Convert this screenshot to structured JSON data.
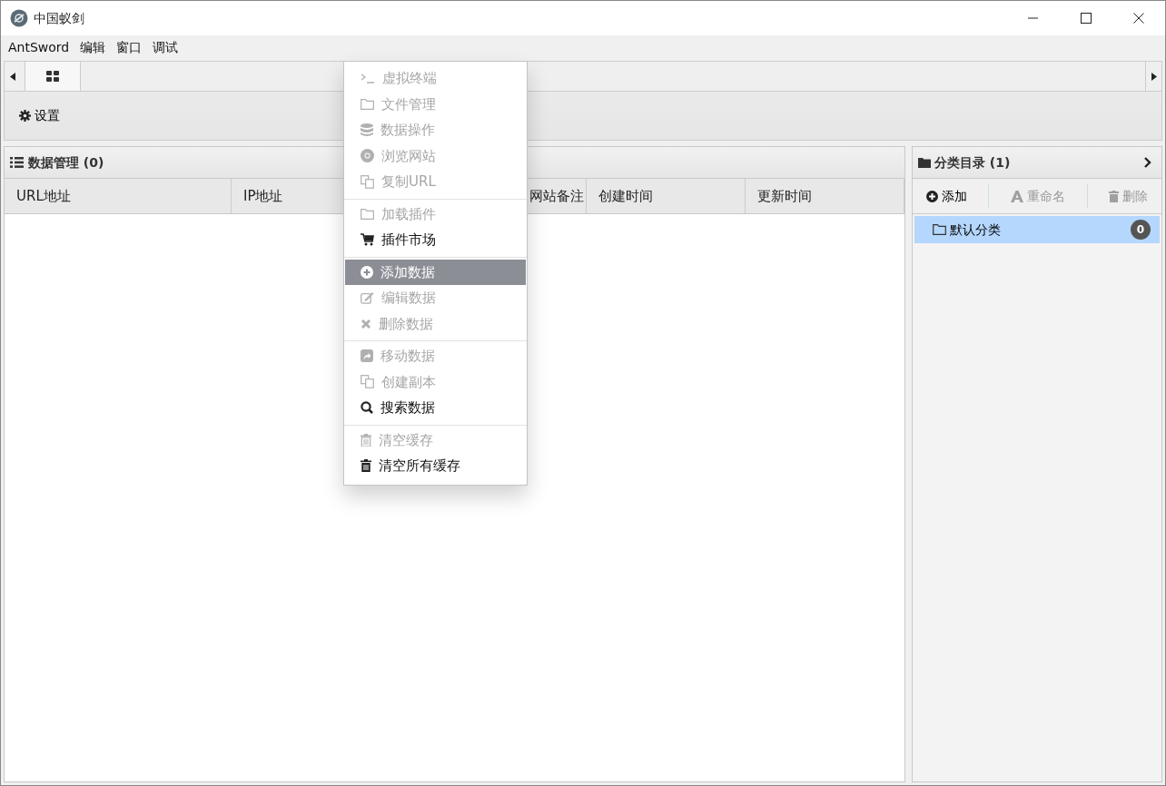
{
  "window": {
    "title": "中国蚁剑"
  },
  "menubar": [
    "AntSword",
    "编辑",
    "窗口",
    "调试"
  ],
  "tabs": [
    {
      "selected": true
    }
  ],
  "toolbar": {
    "settings": "设置"
  },
  "data_panel": {
    "title": "数据管理 (0)",
    "columns": [
      "URL地址",
      "IP地址",
      "网站备注",
      "创建时间",
      "更新时间"
    ]
  },
  "category_panel": {
    "title": "分类目录 (1)",
    "buttons": [
      {
        "label": "添加",
        "disabled": false
      },
      {
        "label": "重命名",
        "disabled": true
      },
      {
        "label": "删除",
        "disabled": true
      }
    ],
    "items": [
      {
        "label": "默认分类",
        "count": "0",
        "selected": true
      }
    ]
  },
  "context_menu": {
    "sections": [
      {
        "items": [
          {
            "label": "虚拟终端",
            "disabled": true,
            "selected": false
          },
          {
            "label": "文件管理",
            "disabled": true,
            "selected": false
          },
          {
            "label": "数据操作",
            "disabled": true,
            "selected": false
          },
          {
            "label": "浏览网站",
            "disabled": true,
            "selected": false
          },
          {
            "label": "复制URL",
            "disabled": true,
            "selected": false
          }
        ]
      },
      {
        "items": [
          {
            "label": "加载插件",
            "disabled": true,
            "selected": false
          },
          {
            "label": "插件市场",
            "disabled": false,
            "selected": false
          }
        ]
      },
      {
        "items": [
          {
            "label": "添加数据",
            "disabled": false,
            "selected": true
          },
          {
            "label": "编辑数据",
            "disabled": true,
            "selected": false
          },
          {
            "label": "删除数据",
            "disabled": true,
            "selected": false
          }
        ]
      },
      {
        "items": [
          {
            "label": "移动数据",
            "disabled": true,
            "selected": false
          },
          {
            "label": "创建副本",
            "disabled": true,
            "selected": false
          },
          {
            "label": "搜索数据",
            "disabled": false,
            "selected": false
          }
        ]
      },
      {
        "items": [
          {
            "label": "清空缓存",
            "disabled": true,
            "selected": false
          },
          {
            "label": "清空所有缓存",
            "disabled": false,
            "selected": false
          }
        ]
      }
    ]
  }
}
